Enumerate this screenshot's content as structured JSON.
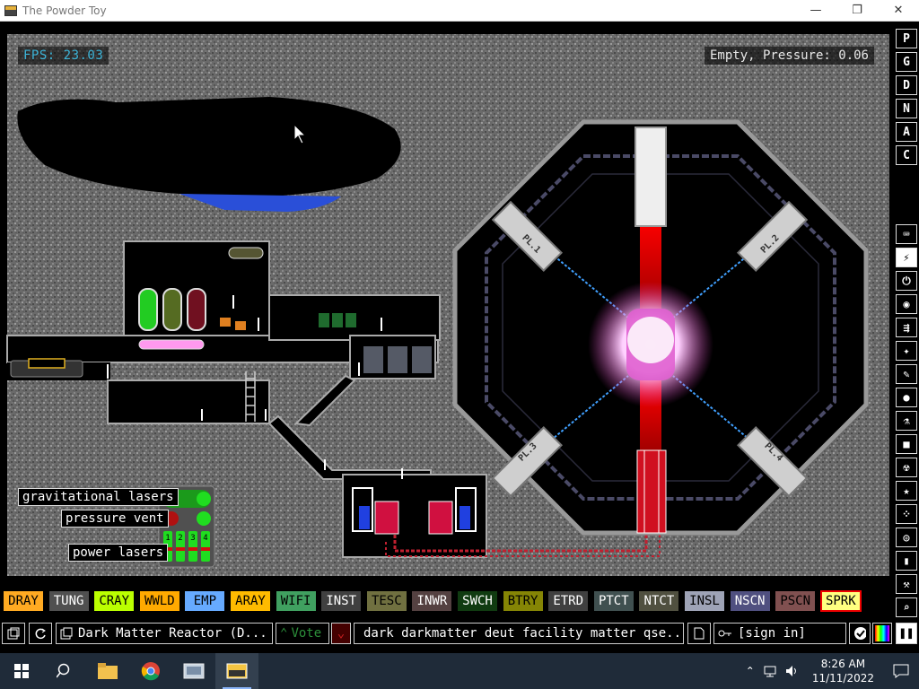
{
  "window": {
    "title": "The Powder Toy"
  },
  "hud": {
    "fps": "FPS: 23.03",
    "status": "Empty, Pressure: 0.06"
  },
  "labels": {
    "gravitational": "gravitational lasers",
    "vent": "pressure vent",
    "power": "power lasers",
    "laser_tags": [
      "PL.1",
      "PL.2",
      "PL.3",
      "PL.4"
    ],
    "panel_digits": [
      "1",
      "2",
      "3",
      "4"
    ]
  },
  "right_menu": {
    "top": [
      "P",
      "G",
      "D",
      "N",
      "A",
      "C"
    ],
    "categories": [
      "keyboard-icon",
      "plug-icon",
      "power-icon",
      "sensor-icon",
      "force-icon",
      "explosive-icon",
      "pen-icon",
      "drop-icon",
      "flask-icon",
      "box-icon",
      "radioactive-icon",
      "star-icon",
      "dots-icon",
      "lightbulb-icon",
      "bookmark-icon",
      "tool-icon",
      "search-icon"
    ],
    "selected_index": 1
  },
  "elements": [
    {
      "name": "DRAY",
      "bg": "#ffaa22",
      "fg": "#000000"
    },
    {
      "name": "TUNG",
      "bg": "#505050",
      "fg": "#ffffff"
    },
    {
      "name": "CRAY",
      "bg": "#bbff00",
      "fg": "#000000"
    },
    {
      "name": "WWLD",
      "bg": "#ffaa00",
      "fg": "#000000"
    },
    {
      "name": "EMP",
      "bg": "#66aaff",
      "fg": "#000000"
    },
    {
      "name": "ARAY",
      "bg": "#ffbb00",
      "fg": "#000000"
    },
    {
      "name": "WIFI",
      "bg": "#40a060",
      "fg": "#000000"
    },
    {
      "name": "INST",
      "bg": "#404040",
      "fg": "#ffffff"
    },
    {
      "name": "TESC",
      "bg": "#707040",
      "fg": "#000000"
    },
    {
      "name": "INWR",
      "bg": "#544141",
      "fg": "#ffffff"
    },
    {
      "name": "SWCH",
      "bg": "#103b11",
      "fg": "#ffffff"
    },
    {
      "name": "BTRY",
      "bg": "#858505",
      "fg": "#000000"
    },
    {
      "name": "ETRD",
      "bg": "#404040",
      "fg": "#ffffff"
    },
    {
      "name": "PTCT",
      "bg": "#405050",
      "fg": "#ffffff"
    },
    {
      "name": "NTCT",
      "bg": "#505040",
      "fg": "#ffffff"
    },
    {
      "name": "INSL",
      "bg": "#9ea3b6",
      "fg": "#000000"
    },
    {
      "name": "NSCN",
      "bg": "#505080",
      "fg": "#ffffff"
    },
    {
      "name": "PSCN",
      "bg": "#805050",
      "fg": "#000000"
    },
    {
      "name": "SPRK",
      "bg": "#ffff80",
      "fg": "#000000",
      "selected": true
    }
  ],
  "bottom": {
    "save_name": "Dark Matter Reactor (D...",
    "vote": "Vote",
    "tags": "dark darkmatter deut facility matter qse...",
    "login": "[sign in]"
  },
  "taskbar": {
    "time": "8:26 AM",
    "date": "11/11/2022",
    "apps": [
      "windows-start-icon",
      "search-icon",
      "file-explorer-icon",
      "chrome-icon",
      "app-icon",
      "powder-toy-icon"
    ]
  }
}
